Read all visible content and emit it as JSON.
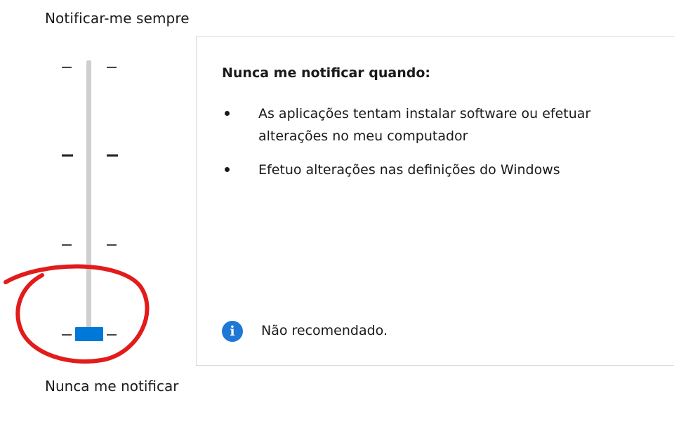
{
  "labels": {
    "top": "Notificar-me sempre",
    "bottom": "Nunca me notificar"
  },
  "slider": {
    "levels": 4,
    "selected_level": 1,
    "thumb_color": "#0078d7"
  },
  "panel": {
    "title": "Nunca me notificar quando:",
    "items": [
      {
        "text": "As aplicações tentam instalar software ou efetuar alterações no meu computador"
      },
      {
        "text": "Efetuo alterações nas definições do Windows"
      }
    ],
    "info_icon": "info-icon",
    "info_text": "Não recomendado."
  },
  "annotation": {
    "shape": "hand-drawn circle",
    "color": "#e21b1b"
  }
}
